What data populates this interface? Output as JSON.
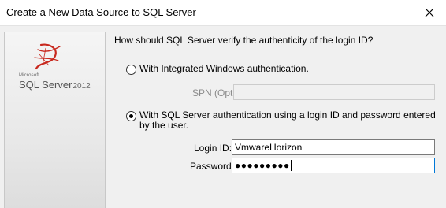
{
  "window": {
    "title": "Create a New Data Source to SQL Server"
  },
  "logo": {
    "microsoft": "Microsoft",
    "product": "SQL Server",
    "version": "2012"
  },
  "form": {
    "question": "How should SQL Server verify the authenticity of the login ID?",
    "option_windows": "With Integrated Windows authentication.",
    "spn_label": "SPN (Optional):",
    "spn_value": "",
    "option_sql": "With SQL Server authentication using a login ID and password entered by the user.",
    "selected_option": "sql",
    "login_label": "Login ID:",
    "login_value": "VmwareHorizon",
    "password_label": "Password:",
    "password_value": "●●●●●●●●●"
  },
  "colors": {
    "focus_border": "#0078d7",
    "logo_red": "#c8281e"
  },
  "icons": {
    "close": "close-icon",
    "logo": "sql-server-logo-icon"
  }
}
